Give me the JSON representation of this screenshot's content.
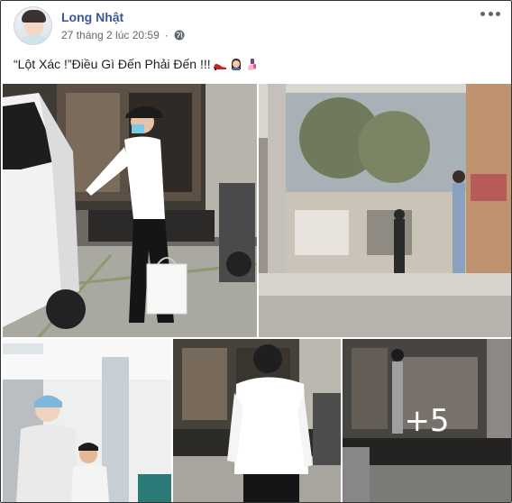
{
  "post": {
    "author": "Long Nhật",
    "timestamp": "27 tháng 2 lúc 20:59",
    "privacy_icon": "globe-icon",
    "caption": "“Lột Xác !”Điều Gì Đến Phải Đến !!!",
    "caption_emojis": [
      "high-heel-shoe-emoji",
      "woman-emoji",
      "nail-polish-emoji"
    ],
    "more_count": "+5"
  },
  "colors": {
    "author_link": "#385898",
    "meta_text": "#616770",
    "body_text": "#1c1e21"
  }
}
